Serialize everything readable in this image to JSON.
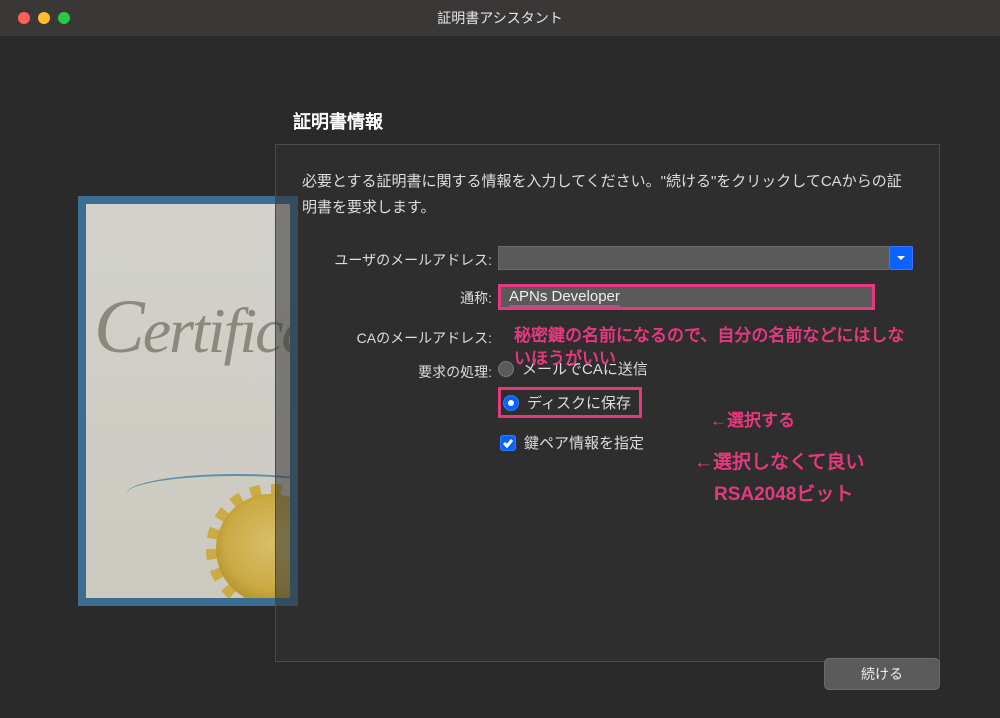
{
  "window": {
    "title": "証明書アシスタント"
  },
  "panel": {
    "heading": "証明書情報",
    "instructions": "必要とする証明書に関する情報を入力してください。\"続ける\"をクリックしてCAからの証明書を要求します。"
  },
  "form": {
    "user_email_label": "ユーザのメールアドレス:",
    "user_email_value": "",
    "common_name_label": "通称:",
    "common_name_value": "APNs Developer",
    "ca_email_label": "CAのメールアドレス:",
    "request_label": "要求の処理:",
    "radio_email": "メールでCAに送信",
    "radio_disk": "ディスクに保存",
    "checkbox_keypair": "鍵ペア情報を指定"
  },
  "annotations": {
    "name_note": "秘密鍵の名前になるので、自分の名前などにはしないほうがいい",
    "select_note": "←選択する",
    "no_select_note1": "←選択しなくて良い",
    "no_select_note2": "RSA2048ビット"
  },
  "buttons": {
    "continue": "続ける"
  },
  "decor": {
    "certificate_word": "Certificate"
  }
}
